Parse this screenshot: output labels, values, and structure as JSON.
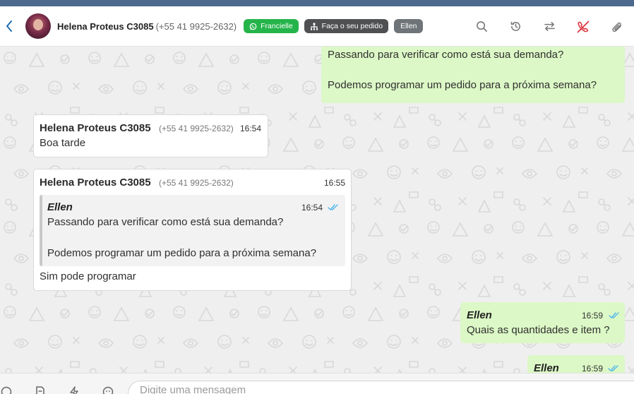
{
  "header": {
    "contact_name": "Helena Proteus C3085",
    "contact_phone": "(+55 41 9925-2632)",
    "tags": {
      "whatsapp_agent": "Francielle",
      "pipeline": "Faça o seu pedido",
      "assignee": "Ellen"
    }
  },
  "messages": {
    "m1": {
      "line1": "Passando para verificar como está sua demanda?",
      "line2": "Podemos programar um pedido para a próxima semana?"
    },
    "m2": {
      "sender": "Helena Proteus C3085",
      "phone": "(+55 41 9925-2632)",
      "time": "16:54",
      "text": "Boa tarde"
    },
    "m3": {
      "sender": "Helena Proteus C3085",
      "phone": "(+55 41 9925-2632)",
      "time": "16:55",
      "quote": {
        "sender": "Ellen",
        "time": "16:54",
        "line1": "Passando para verificar como está sua demanda?",
        "line2": "Podemos programar um pedido para a próxima semana?"
      },
      "text": "Sim pode programar"
    },
    "m4": {
      "sender": "Ellen",
      "time": "16:59",
      "text": "Quais as quantidades e item ?"
    },
    "m5": {
      "sender": "Ellen",
      "time": "16:59"
    }
  },
  "composer": {
    "placeholder": "Digite uma mensagem"
  },
  "colors": {
    "accent_green": "#25b44a",
    "outgoing_bubble": "#dcf8c6",
    "read_tick": "#4fb6ec",
    "end_call_red": "#e0303b"
  },
  "icons": {
    "back": "chevron-left-icon",
    "whatsapp": "whatsapp-icon",
    "pipeline": "sitemap-icon",
    "search": "search-icon",
    "history": "history-icon",
    "transfer": "transfer-icon",
    "end_call": "end-call-icon",
    "attach": "paperclip-icon",
    "read_receipt": "double-check-icon"
  }
}
